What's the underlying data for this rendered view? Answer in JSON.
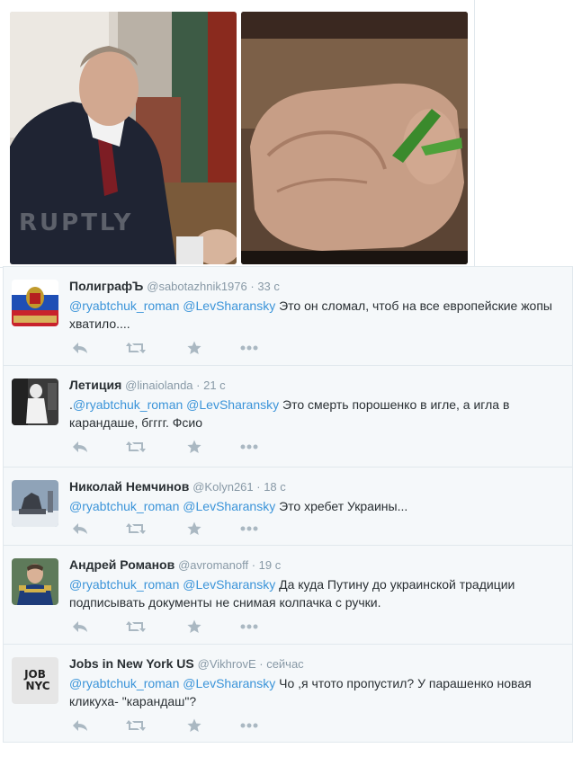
{
  "media": {
    "left_photo": {
      "watermark": "RUPTLY"
    }
  },
  "tweets": [
    {
      "fullname": "ПолиграфЪ",
      "username": "@sabotazhnik1976",
      "time": "33 с",
      "text_prefix": "",
      "mention1": "@ryabtchuk_roman",
      "mention2": "@LevSharansky",
      "text": "Это он сломал, чтоб на все европейские жопы хватило...."
    },
    {
      "fullname": "Летиция",
      "username": "@linaiolanda",
      "time": "21 с",
      "text_prefix": ".",
      "mention1": "@ryabtchuk_roman",
      "mention2": "@LevSharansky",
      "text": "Это смерть порошенко в игле, а игла в карандаше, бгггг. Фсио"
    },
    {
      "fullname": "Николай Немчинов",
      "username": "@Kolyn261",
      "time": "18 с",
      "text_prefix": "",
      "mention1": "@ryabtchuk_roman",
      "mention2": "@LevSharansky",
      "text": "Это хребет Украины..."
    },
    {
      "fullname": "Андрей Романов",
      "username": "@avromanoff",
      "time": "19 с",
      "text_prefix": "",
      "mention1": "@ryabtchuk_roman",
      "mention2": "@LevSharansky",
      "text": "Да куда Путину до украинской традиции подписывать документы не снимая колпачка с ручки."
    },
    {
      "fullname": "Jobs in New York US",
      "username": "@VikhrovE",
      "time": "сейчас",
      "text_prefix": "",
      "mention1": "@ryabtchuk_roman",
      "mention2": "@LevSharansky",
      "text": "Чо ,я чтото пропустил? У парашенко новая кликуха- \"карандаш\"?",
      "avatar_line1": "JOB",
      "avatar_line2": "NYC"
    }
  ],
  "separator": " · ",
  "colors": {
    "link": "#3b94d9",
    "muted": "#8899a6",
    "icon": "#aab8c2"
  },
  "icons": [
    "reply-icon",
    "retweet-icon",
    "favorite-icon",
    "more-icon"
  ]
}
